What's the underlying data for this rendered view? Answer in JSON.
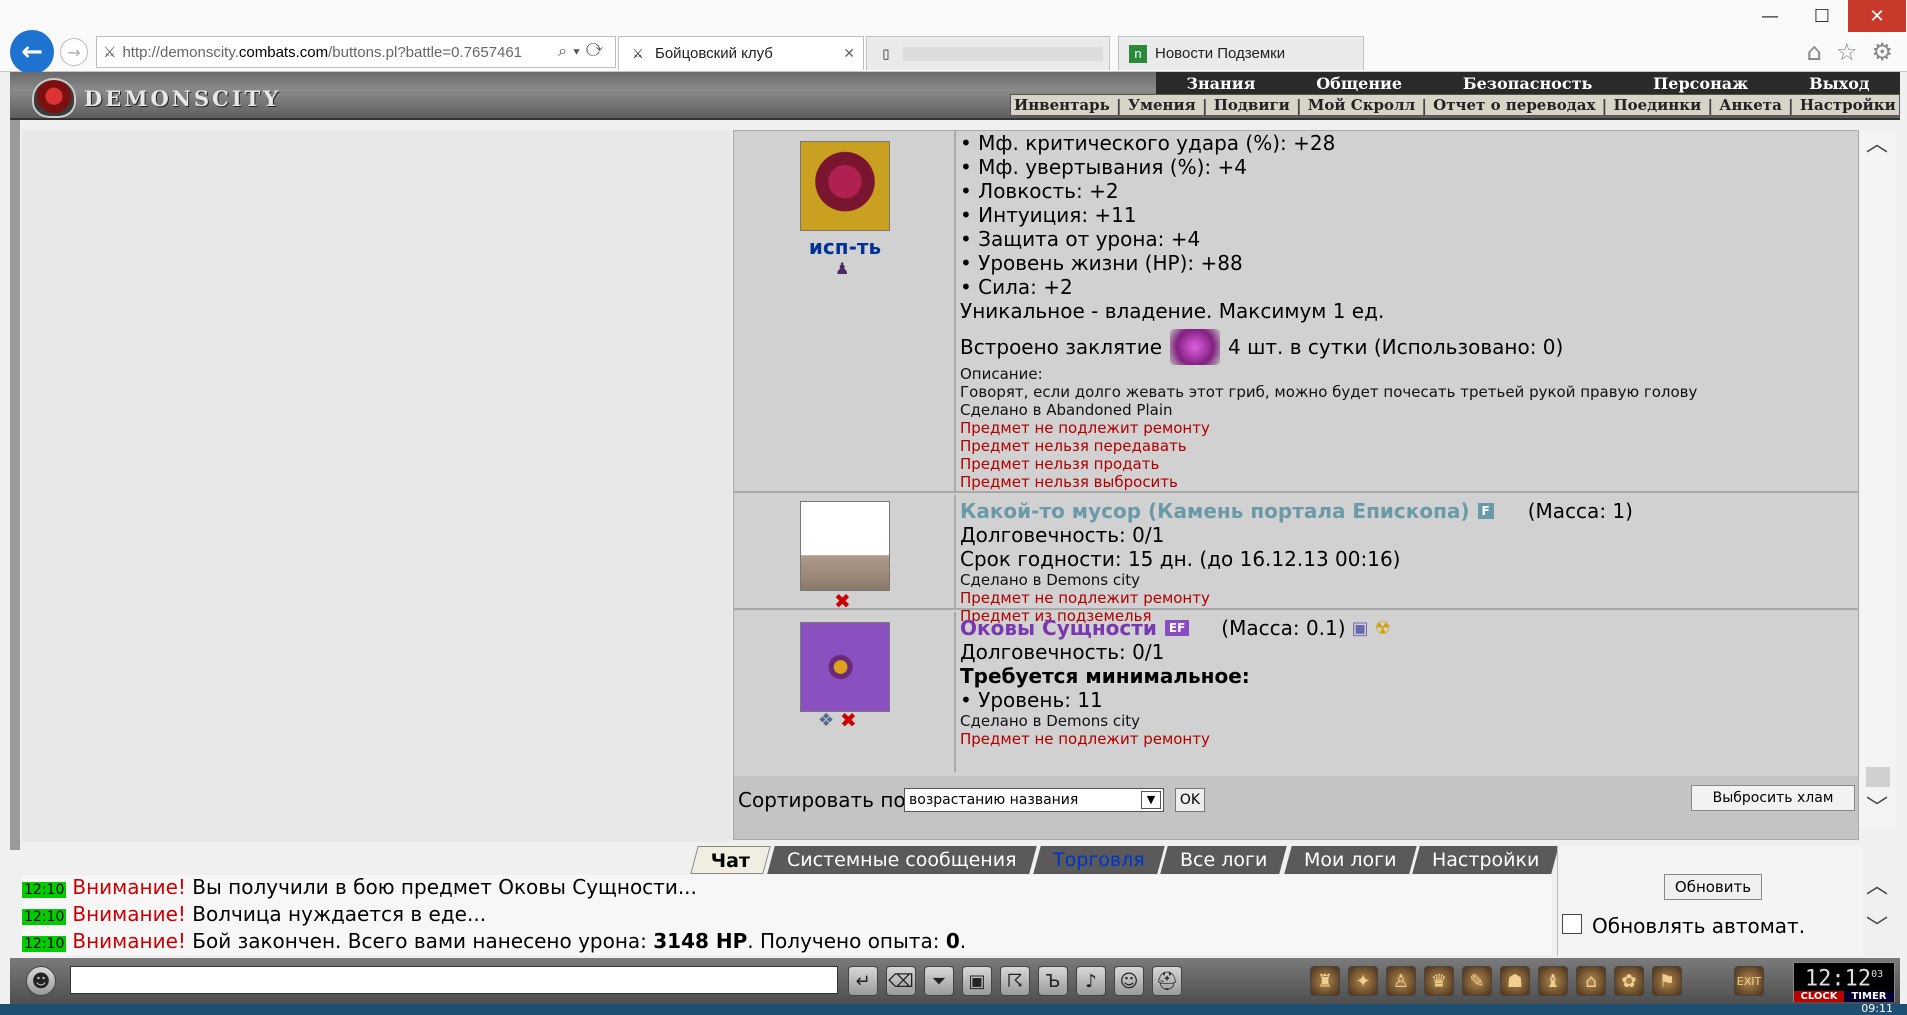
{
  "browser": {
    "url_prefix": "http://demonscity.",
    "url_domain": "combats.com",
    "url_suffix": "/buttons.pl?battle=0.7657461",
    "tabs": [
      {
        "label": "Бойцовский клуб",
        "close": "✕"
      },
      {
        "label": "",
        "close": ""
      },
      {
        "label": "Новости Подземки",
        "close": ""
      }
    ],
    "window_controls": {
      "minimize": "—",
      "maximize": "☐",
      "close": "✕"
    }
  },
  "header": {
    "logo_text": "DEMONSCITY",
    "menu_top": [
      "Знания",
      "Общение",
      "Безопасность",
      "Персонаж",
      "Выход"
    ],
    "menu_sub": [
      "Инвентарь",
      "Умения",
      "Подвиги",
      "Мой Скролл",
      "Отчет о переводах",
      "Поединки",
      "Анкета",
      "Настройки"
    ],
    "menu_sep": "|"
  },
  "items": {
    "first": {
      "action_label": "исп-ть",
      "lines": [
        "• Мф. критического удара (%): +28",
        "• Мф. увертывания (%): +4",
        "• Ловкость: +2",
        "• Интуиция: +11",
        "• Защита от урона: +4",
        "• Уровень жизни (HP): +88",
        "• Сила: +2",
        "Уникальное - владение. Максимум 1 ед."
      ],
      "spell_prefix": "Встроено заклятие",
      "spell_suffix": "4 шт. в сутки (Использовано: 0)",
      "desc_label": "Описание:",
      "desc_text": "Говорят, если долго жевать этот гриб, можно будет почесать третьей рукой правую голову",
      "made_in": "Сделано в Abandoned Plain",
      "restrictions": [
        "Предмет не подлежит ремонту",
        "Предмет нельзя передавать",
        "Предмет нельзя продать",
        "Предмет нельзя выбросить"
      ]
    },
    "second": {
      "title": "Какой-то мусор (Камень портала Епископа)",
      "badge": "F",
      "mass": "(Масса: 1)",
      "durability": "Долговечность: 0/1",
      "expiry": "Срок годности: 15 дн. (до 16.12.13 00:16)",
      "made_in": "Сделано в Demons city",
      "restrictions": [
        "Предмет не подлежит ремонту",
        "Предмет из подземелья"
      ]
    },
    "third": {
      "title": "Оковы Сущности",
      "badge": "EF",
      "mass": "(Масса: 0.1)",
      "durability": "Долговечность: 0/1",
      "req_title": "Требуется минимальное:",
      "req_level": "• Уровень: 11",
      "made_in": "Сделано в Demons city",
      "restrictions": [
        "Предмет не подлежит ремонту"
      ]
    }
  },
  "sort": {
    "label": "Сортировать по",
    "selected": "возрастанию названия",
    "ok": "OK",
    "junk_button": "Выбросить хлам"
  },
  "chat": {
    "tabs": [
      "Чат",
      "Системные сообщения",
      "Торговля",
      "Все логи",
      "Мои логи",
      "Настройки"
    ],
    "messages": [
      {
        "time": "12:10",
        "warn": "Внимание!",
        "text": " Вы получили в бою предмет Оковы Сущности..."
      },
      {
        "time": "12:10",
        "warn": "Внимание!",
        "text": " Волчица нуждается в еде..."
      },
      {
        "time": "12:10",
        "warn": "Внимание!",
        "text_a": " Бой закончен. Всего вами нанесено урона: ",
        "bold_a": "3148 HP",
        "text_b": ". Получено опыта: ",
        "bold_b": "0",
        "text_c": "."
      }
    ],
    "refresh_button": "Обновить",
    "auto_label": "Обновлять автомат."
  },
  "bottom": {
    "clock_time": "12:12",
    "clock_seconds": "03",
    "clock_label": "CLOCK",
    "timer_label": "TIMER",
    "system_time": "09:11"
  },
  "colors": {
    "item_title_gray": "#6a9aa8",
    "item_title_purple": "#7a38b0",
    "badge_bg": "#6a9aa8",
    "badge_purple": "#8a4ac0",
    "restriction_red": "#b00000",
    "action_blue": "#003399"
  },
  "icons": {
    "back": "arrow-left-icon",
    "forward": "arrow-right-icon",
    "search": "search-icon",
    "refresh": "refresh-icon",
    "home": "home-icon",
    "star": "star-icon",
    "gear": "gear-icon"
  }
}
